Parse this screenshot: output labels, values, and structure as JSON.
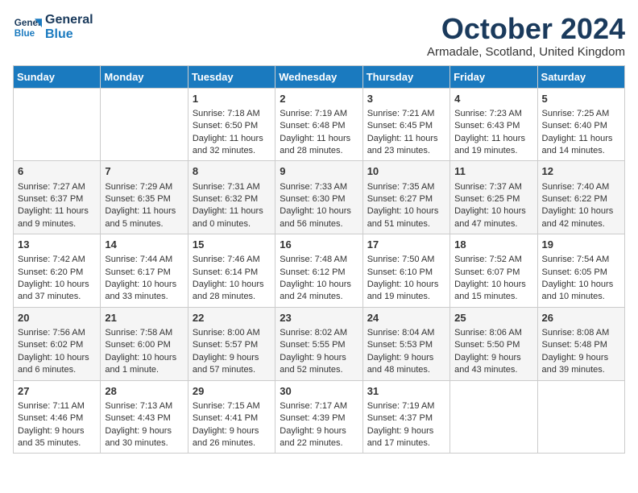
{
  "logo": {
    "line1": "General",
    "line2": "Blue"
  },
  "title": "October 2024",
  "subtitle": "Armadale, Scotland, United Kingdom",
  "days_of_week": [
    "Sunday",
    "Monday",
    "Tuesday",
    "Wednesday",
    "Thursday",
    "Friday",
    "Saturday"
  ],
  "weeks": [
    [
      {
        "day": "",
        "content": ""
      },
      {
        "day": "",
        "content": ""
      },
      {
        "day": "1",
        "content": "Sunrise: 7:18 AM\nSunset: 6:50 PM\nDaylight: 11 hours\nand 32 minutes."
      },
      {
        "day": "2",
        "content": "Sunrise: 7:19 AM\nSunset: 6:48 PM\nDaylight: 11 hours\nand 28 minutes."
      },
      {
        "day": "3",
        "content": "Sunrise: 7:21 AM\nSunset: 6:45 PM\nDaylight: 11 hours\nand 23 minutes."
      },
      {
        "day": "4",
        "content": "Sunrise: 7:23 AM\nSunset: 6:43 PM\nDaylight: 11 hours\nand 19 minutes."
      },
      {
        "day": "5",
        "content": "Sunrise: 7:25 AM\nSunset: 6:40 PM\nDaylight: 11 hours\nand 14 minutes."
      }
    ],
    [
      {
        "day": "6",
        "content": "Sunrise: 7:27 AM\nSunset: 6:37 PM\nDaylight: 11 hours\nand 9 minutes."
      },
      {
        "day": "7",
        "content": "Sunrise: 7:29 AM\nSunset: 6:35 PM\nDaylight: 11 hours\nand 5 minutes."
      },
      {
        "day": "8",
        "content": "Sunrise: 7:31 AM\nSunset: 6:32 PM\nDaylight: 11 hours\nand 0 minutes."
      },
      {
        "day": "9",
        "content": "Sunrise: 7:33 AM\nSunset: 6:30 PM\nDaylight: 10 hours\nand 56 minutes."
      },
      {
        "day": "10",
        "content": "Sunrise: 7:35 AM\nSunset: 6:27 PM\nDaylight: 10 hours\nand 51 minutes."
      },
      {
        "day": "11",
        "content": "Sunrise: 7:37 AM\nSunset: 6:25 PM\nDaylight: 10 hours\nand 47 minutes."
      },
      {
        "day": "12",
        "content": "Sunrise: 7:40 AM\nSunset: 6:22 PM\nDaylight: 10 hours\nand 42 minutes."
      }
    ],
    [
      {
        "day": "13",
        "content": "Sunrise: 7:42 AM\nSunset: 6:20 PM\nDaylight: 10 hours\nand 37 minutes."
      },
      {
        "day": "14",
        "content": "Sunrise: 7:44 AM\nSunset: 6:17 PM\nDaylight: 10 hours\nand 33 minutes."
      },
      {
        "day": "15",
        "content": "Sunrise: 7:46 AM\nSunset: 6:14 PM\nDaylight: 10 hours\nand 28 minutes."
      },
      {
        "day": "16",
        "content": "Sunrise: 7:48 AM\nSunset: 6:12 PM\nDaylight: 10 hours\nand 24 minutes."
      },
      {
        "day": "17",
        "content": "Sunrise: 7:50 AM\nSunset: 6:10 PM\nDaylight: 10 hours\nand 19 minutes."
      },
      {
        "day": "18",
        "content": "Sunrise: 7:52 AM\nSunset: 6:07 PM\nDaylight: 10 hours\nand 15 minutes."
      },
      {
        "day": "19",
        "content": "Sunrise: 7:54 AM\nSunset: 6:05 PM\nDaylight: 10 hours\nand 10 minutes."
      }
    ],
    [
      {
        "day": "20",
        "content": "Sunrise: 7:56 AM\nSunset: 6:02 PM\nDaylight: 10 hours\nand 6 minutes."
      },
      {
        "day": "21",
        "content": "Sunrise: 7:58 AM\nSunset: 6:00 PM\nDaylight: 10 hours\nand 1 minute."
      },
      {
        "day": "22",
        "content": "Sunrise: 8:00 AM\nSunset: 5:57 PM\nDaylight: 9 hours\nand 57 minutes."
      },
      {
        "day": "23",
        "content": "Sunrise: 8:02 AM\nSunset: 5:55 PM\nDaylight: 9 hours\nand 52 minutes."
      },
      {
        "day": "24",
        "content": "Sunrise: 8:04 AM\nSunset: 5:53 PM\nDaylight: 9 hours\nand 48 minutes."
      },
      {
        "day": "25",
        "content": "Sunrise: 8:06 AM\nSunset: 5:50 PM\nDaylight: 9 hours\nand 43 minutes."
      },
      {
        "day": "26",
        "content": "Sunrise: 8:08 AM\nSunset: 5:48 PM\nDaylight: 9 hours\nand 39 minutes."
      }
    ],
    [
      {
        "day": "27",
        "content": "Sunrise: 7:11 AM\nSunset: 4:46 PM\nDaylight: 9 hours\nand 35 minutes."
      },
      {
        "day": "28",
        "content": "Sunrise: 7:13 AM\nSunset: 4:43 PM\nDaylight: 9 hours\nand 30 minutes."
      },
      {
        "day": "29",
        "content": "Sunrise: 7:15 AM\nSunset: 4:41 PM\nDaylight: 9 hours\nand 26 minutes."
      },
      {
        "day": "30",
        "content": "Sunrise: 7:17 AM\nSunset: 4:39 PM\nDaylight: 9 hours\nand 22 minutes."
      },
      {
        "day": "31",
        "content": "Sunrise: 7:19 AM\nSunset: 4:37 PM\nDaylight: 9 hours\nand 17 minutes."
      },
      {
        "day": "",
        "content": ""
      },
      {
        "day": "",
        "content": ""
      }
    ]
  ]
}
